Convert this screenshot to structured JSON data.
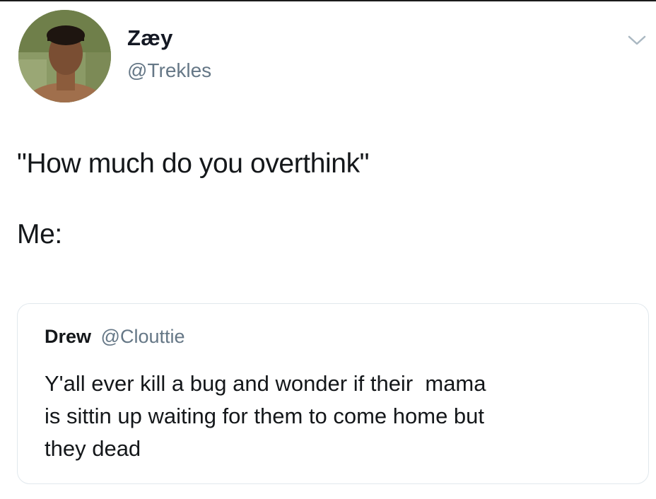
{
  "tweet": {
    "author": {
      "display_name": "Zæy",
      "handle": "@Trekles",
      "avatar_icon": "avatar-photo"
    },
    "menu_icon": "chevron-down-icon",
    "text_lines": [
      "\"How much do you overthink\"",
      "Me:"
    ]
  },
  "quoted_tweet": {
    "author_name": "Drew",
    "author_handle": "@Clouttie",
    "text_lines": [
      "Y'all ever kill a bug and wonder if their  mama",
      "is sittin up waiting for them to come home but",
      "they dead"
    ]
  },
  "colors": {
    "primary_text": "#14171a",
    "secondary_text": "#657786",
    "card_border": "#e1e8ed"
  }
}
